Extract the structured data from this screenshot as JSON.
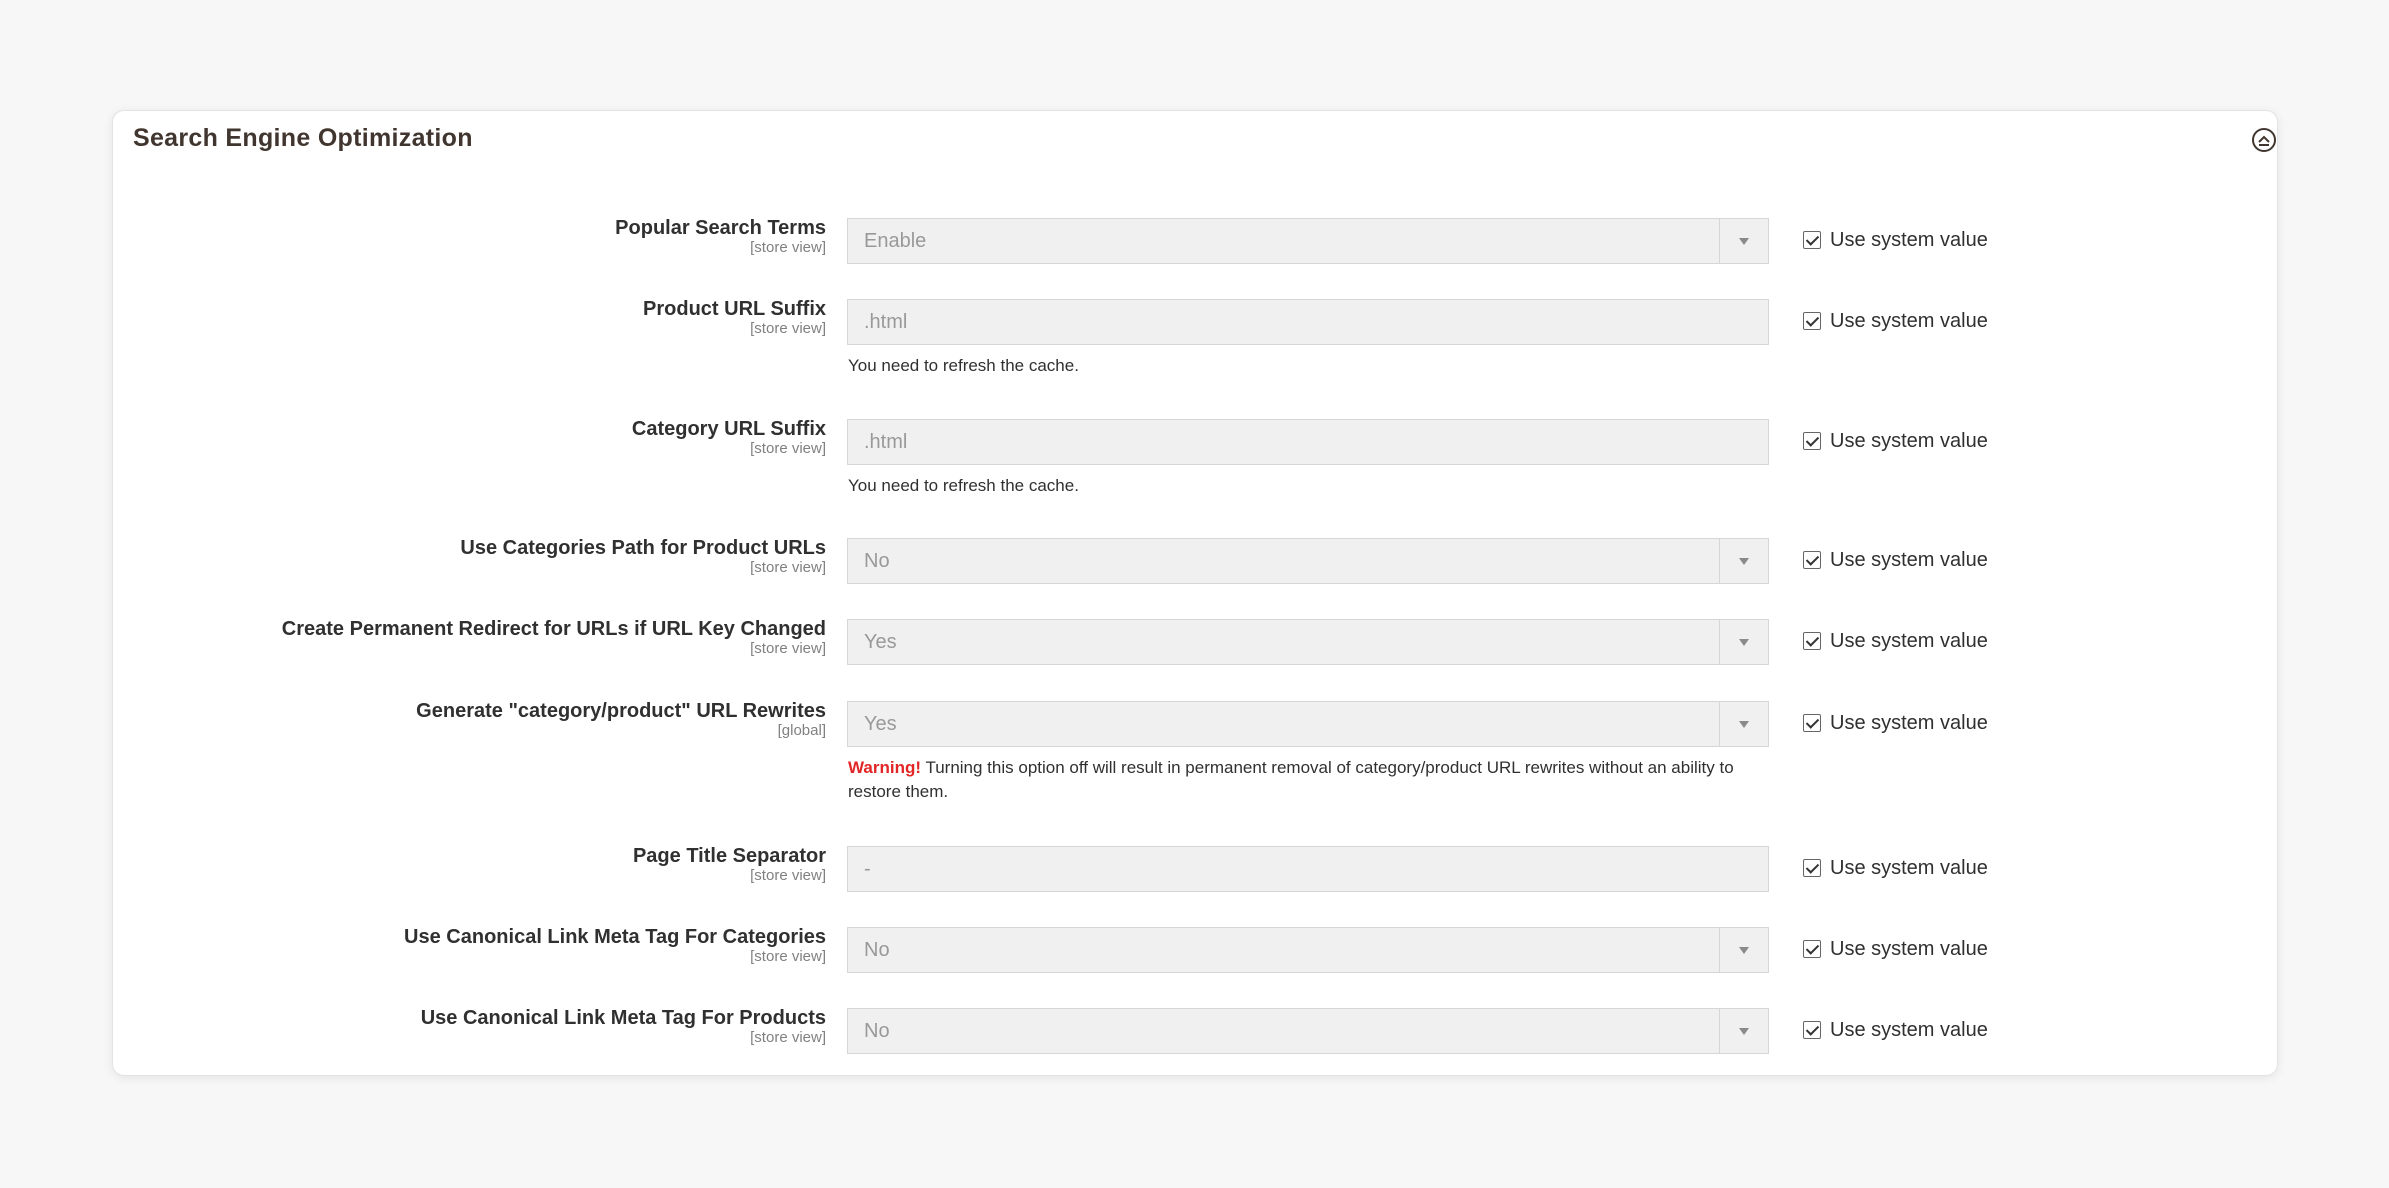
{
  "section": {
    "title": "Search Engine Optimization",
    "collapse_icon": "chevron-up-circle-icon"
  },
  "use_system_value_label": "Use system value",
  "fields": [
    {
      "label": "Popular Search Terms",
      "scope": "[store view]",
      "type": "select",
      "value": "Enable",
      "use_system_value": true
    },
    {
      "label": "Product URL Suffix",
      "scope": "[store view]",
      "type": "text",
      "value": ".html",
      "note": "You need to refresh the cache.",
      "use_system_value": true
    },
    {
      "label": "Category URL Suffix",
      "scope": "[store view]",
      "type": "text",
      "value": ".html",
      "note": "You need to refresh the cache.",
      "use_system_value": true
    },
    {
      "label": "Use Categories Path for Product URLs",
      "scope": "[store view]",
      "type": "select",
      "value": "No",
      "use_system_value": true
    },
    {
      "label": "Create Permanent Redirect for URLs if URL Key Changed",
      "scope": "[store view]",
      "type": "select",
      "value": "Yes",
      "use_system_value": true
    },
    {
      "label": "Generate \"category/product\" URL Rewrites",
      "scope": "[global]",
      "type": "select",
      "value": "Yes",
      "warning_prefix": "Warning!",
      "warning_text": " Turning this option off will result in permanent removal of category/product URL rewrites without an ability to restore them.",
      "use_system_value": true
    },
    {
      "label": "Page Title Separator",
      "scope": "[store view]",
      "type": "text",
      "value": "-",
      "use_system_value": true
    },
    {
      "label": "Use Canonical Link Meta Tag For Categories",
      "scope": "[store view]",
      "type": "select",
      "value": "No",
      "use_system_value": true
    },
    {
      "label": "Use Canonical Link Meta Tag For Products",
      "scope": "[store view]",
      "type": "select",
      "value": "No",
      "use_system_value": true
    }
  ]
}
